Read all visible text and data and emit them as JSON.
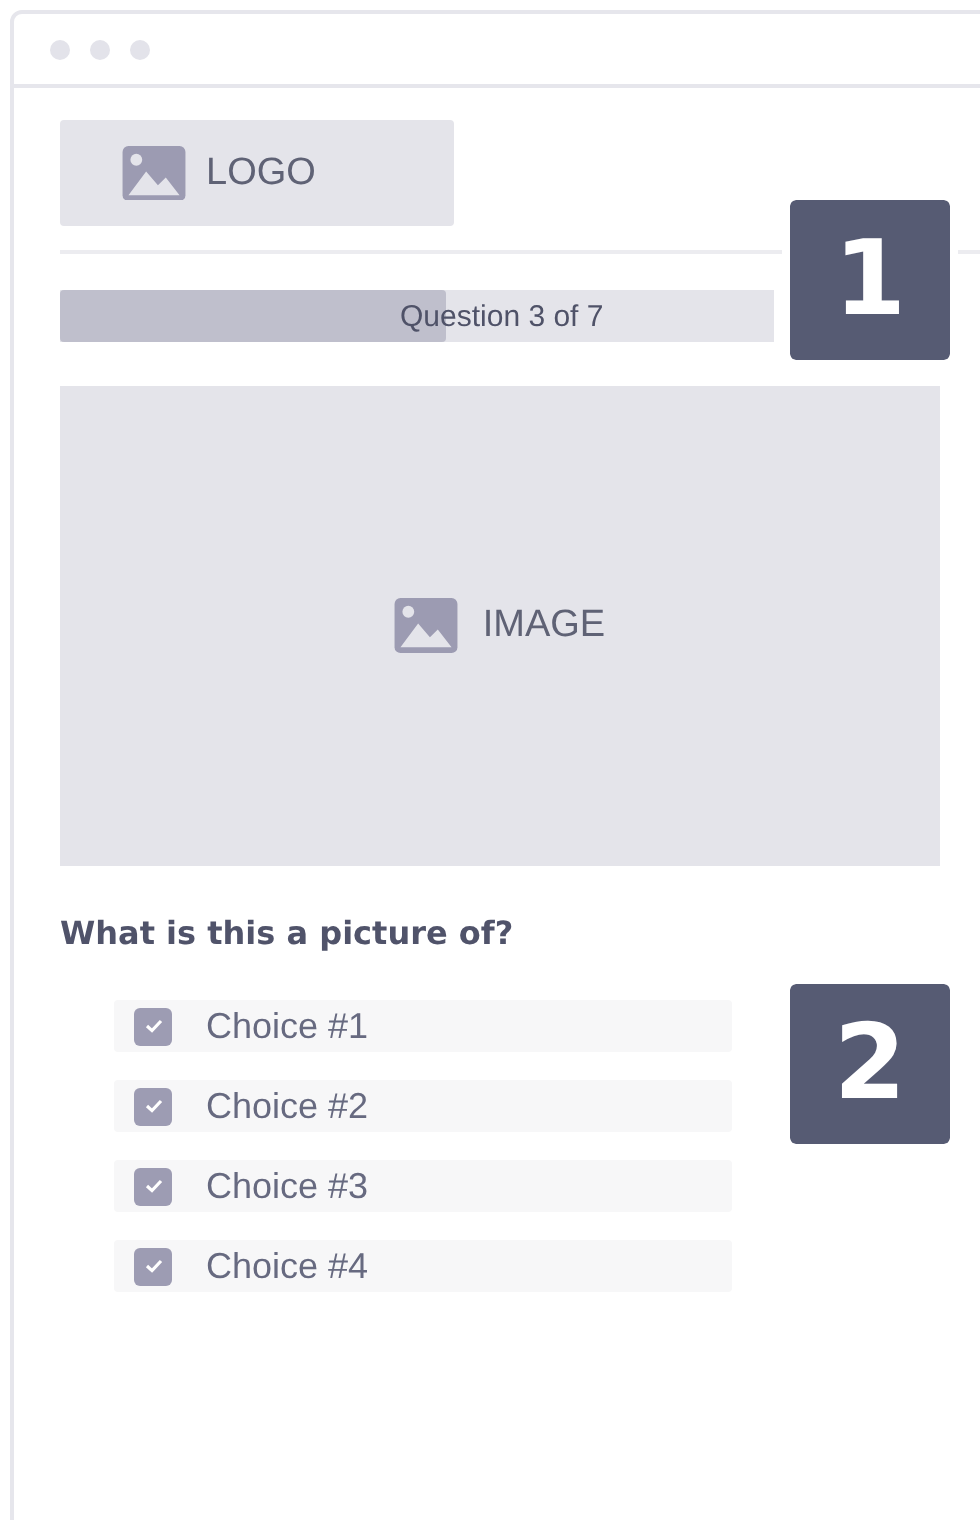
{
  "logo": {
    "label": "LOGO"
  },
  "progress": {
    "label": "Question 3 of 7",
    "level": 0.54
  },
  "image": {
    "label": "IMAGE"
  },
  "question": "What is this a picture of?",
  "choices": [
    {
      "label": "Choice #1",
      "checked": true
    },
    {
      "label": "Choice #2",
      "checked": true
    },
    {
      "label": "Choice #3",
      "checked": true
    },
    {
      "label": "Choice #4",
      "checked": true
    }
  ],
  "callouts": [
    "1",
    "2"
  ]
}
